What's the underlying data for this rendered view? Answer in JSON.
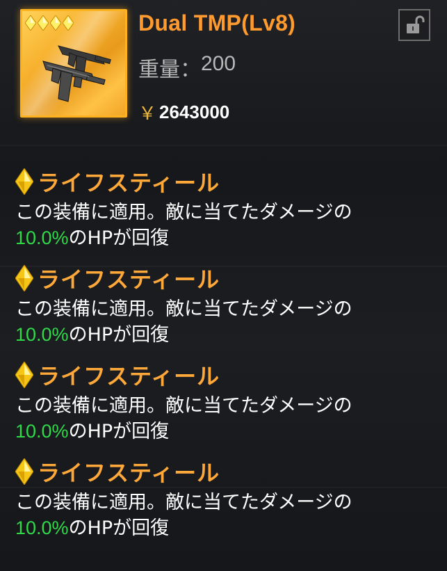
{
  "item": {
    "name": "Dual TMP(Lv8)",
    "weight_label": "重量：",
    "weight_value": "200",
    "currency_symbol": "￥",
    "price": "2643000",
    "rank_gems": 4,
    "image_icon": "dual-tmp-gun-icon",
    "lock_icon": "unlocked-padlock-icon"
  },
  "skills": [
    {
      "name": "ライフスティール",
      "desc_line1": "この装備に適用。敵に当てたダメージの",
      "percent": "10.0%",
      "desc_line2": "のHPが回復"
    },
    {
      "name": "ライフスティール",
      "desc_line1": "この装備に適用。敵に当てたダメージの",
      "percent": "10.0%",
      "desc_line2": "のHPが回復"
    },
    {
      "name": "ライフスティール",
      "desc_line1": "この装備に適用。敵に当てたダメージの",
      "percent": "10.0%",
      "desc_line2": "のHPが回復"
    },
    {
      "name": "ライフスティール",
      "desc_line1": "この装備に適用。敵に当てたダメージの",
      "percent": "10.0%",
      "desc_line2": "のHPが回復"
    }
  ],
  "colors": {
    "accent_orange": "#ff9a2e",
    "gem_gold": "#f5c518",
    "percent_green": "#31d94a",
    "frame_gold": "#ffb21f"
  }
}
